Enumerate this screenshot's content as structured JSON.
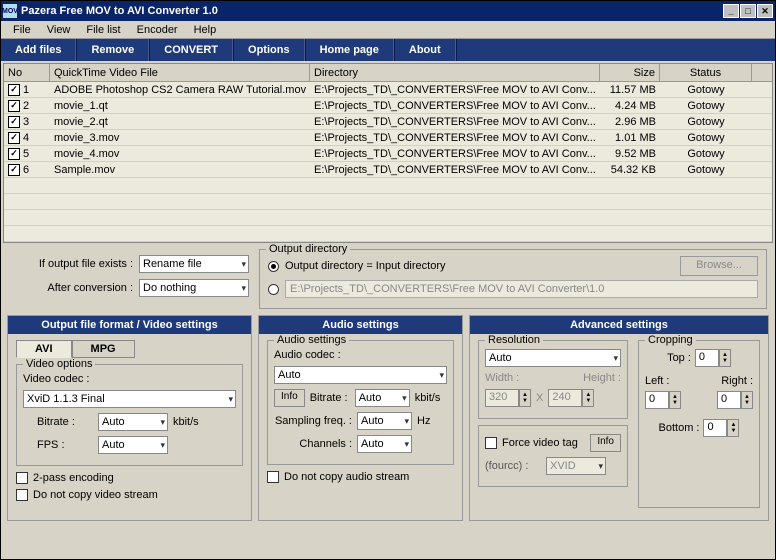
{
  "window": {
    "title": "Pazera Free MOV to AVI Converter 1.0"
  },
  "menu": [
    "File",
    "View",
    "File list",
    "Encoder",
    "Help"
  ],
  "toolbar": [
    "Add files",
    "Remove",
    "CONVERT",
    "Options",
    "Home page",
    "About"
  ],
  "table": {
    "headers": {
      "no": "No",
      "file": "QuickTime Video File",
      "dir": "Directory",
      "size": "Size",
      "status": "Status"
    },
    "rows": [
      {
        "n": "1",
        "file": "ADOBE Photoshop CS2 Camera RAW Tutorial.mov",
        "dir": "E:\\Projects_TD\\_CONVERTERS\\Free MOV to AVI Conv...",
        "size": "11.57 MB",
        "status": "Gotowy"
      },
      {
        "n": "2",
        "file": "movie_1.qt",
        "dir": "E:\\Projects_TD\\_CONVERTERS\\Free MOV to AVI Conv...",
        "size": "4.24 MB",
        "status": "Gotowy"
      },
      {
        "n": "3",
        "file": "movie_2.qt",
        "dir": "E:\\Projects_TD\\_CONVERTERS\\Free MOV to AVI Conv...",
        "size": "2.96 MB",
        "status": "Gotowy"
      },
      {
        "n": "4",
        "file": "movie_3.mov",
        "dir": "E:\\Projects_TD\\_CONVERTERS\\Free MOV to AVI Conv...",
        "size": "1.01 MB",
        "status": "Gotowy"
      },
      {
        "n": "5",
        "file": "movie_4.mov",
        "dir": "E:\\Projects_TD\\_CONVERTERS\\Free MOV to AVI Conv...",
        "size": "9.52 MB",
        "status": "Gotowy"
      },
      {
        "n": "6",
        "file": "Sample.mov",
        "dir": "E:\\Projects_TD\\_CONVERTERS\\Free MOV to AVI Conv...",
        "size": "54.32 KB",
        "status": "Gotowy"
      }
    ]
  },
  "opts": {
    "ifExistsLabel": "If output file exists :",
    "ifExistsValue": "Rename file",
    "afterLabel": "After conversion :",
    "afterValue": "Do nothing",
    "outDirLegend": "Output directory",
    "outDirSame": "Output directory = Input directory",
    "outPath": "E:\\Projects_TD\\_CONVERTERS\\Free MOV to AVI Converter\\1.0",
    "browse": "Browse..."
  },
  "p1": {
    "title": "Output file format / Video settings",
    "tabs": [
      "AVI",
      "MPG"
    ],
    "vopts": "Video options",
    "vcodecLabel": "Video codec :",
    "vcodecValue": "XviD 1.1.3 Final",
    "bitrateLabel": "Bitrate :",
    "bitrateValue": "Auto",
    "kbits": "kbit/s",
    "fpsLabel": "FPS :",
    "fpsValue": "Auto",
    "twopass": "2-pass encoding",
    "novideo": "Do not copy video stream"
  },
  "p2": {
    "title": "Audio settings",
    "grp": "Audio settings",
    "acodecLabel": "Audio codec :",
    "acodecValue": "Auto",
    "info": "Info",
    "abitrateLabel": "Bitrate :",
    "abitrateValue": "Auto",
    "kbits": "kbit/s",
    "sampLabel": "Sampling freq. :",
    "sampValue": "Auto",
    "hz": "Hz",
    "chLabel": "Channels :",
    "chValue": "Auto",
    "noaudio": "Do not copy audio stream"
  },
  "p3": {
    "title": "Advanced settings",
    "resLegend": "Resolution",
    "resValue": "Auto",
    "widthLabel": "Width :",
    "widthValue": "320",
    "x": "X",
    "heightLabel": "Height :",
    "heightValue": "240",
    "force": "Force video tag",
    "info": "Info",
    "fourccLabel": "(fourcc) :",
    "fourccValue": "XVID",
    "cropLegend": "Cropping",
    "topLabel": "Top :",
    "leftLabel": "Left :",
    "rightLabel": "Right :",
    "bottomLabel": "Bottom :",
    "zero": "0"
  }
}
